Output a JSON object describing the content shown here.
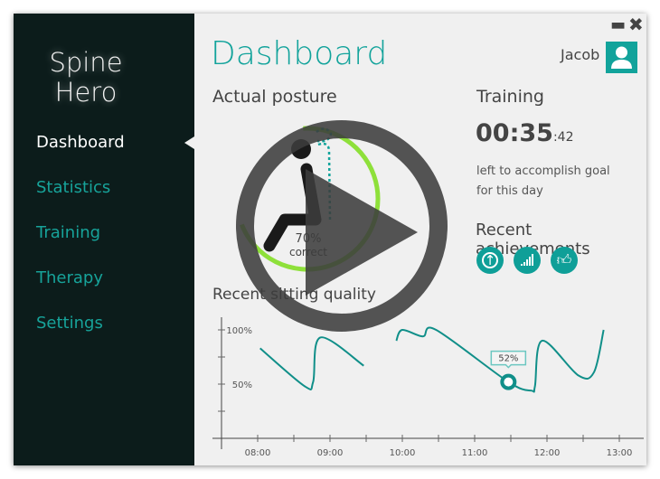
{
  "sidebar": {
    "brand_line1": "Spine",
    "brand_line2": "Hero",
    "items": [
      {
        "label": "Dashboard",
        "active": true
      },
      {
        "label": "Statistics"
      },
      {
        "label": "Training"
      },
      {
        "label": "Therapy"
      },
      {
        "label": "Settings"
      }
    ]
  },
  "header": {
    "title": "Dashboard",
    "user": "Jacob",
    "minimize_icon": "minimize-icon",
    "close_icon": "close-icon"
  },
  "posture": {
    "title": "Actual posture",
    "percent": "70%",
    "label": "correct",
    "correct_fraction": 0.7
  },
  "training": {
    "title": "Training",
    "time_main": "00:35",
    "time_seconds": ":42",
    "caption_line1": "left to accomplish goal",
    "caption_line2": "for this day"
  },
  "achievements": {
    "title": "Recent achievements",
    "icons": [
      "arrow-up-circle-icon",
      "signal-bars-icon",
      "thumbs-up-icon"
    ]
  },
  "overlay": {
    "icon": "play-icon"
  },
  "colors": {
    "accent": "#12a39b",
    "sidebar": "#0c1c1b",
    "arc": "#8ee03a"
  },
  "chart_data": {
    "type": "line",
    "title": "Recent sitting quality",
    "x_ticks": [
      "08:00",
      "09:00",
      "10:00",
      "11:00",
      "12:00",
      "13:00"
    ],
    "y_tick_labels": [
      "100%",
      "50%"
    ],
    "ylim": [
      0,
      100
    ],
    "xlim": [
      "07:30",
      "13:00"
    ],
    "segments": [
      [
        [
          "08:02",
          83
        ],
        [
          "08:39",
          48
        ],
        [
          "08:46",
          52
        ],
        [
          "08:52",
          93
        ],
        [
          "09:28",
          67
        ]
      ],
      [
        [
          "09:55",
          90
        ],
        [
          "10:00",
          100
        ],
        [
          "10:17",
          94
        ],
        [
          "10:28",
          100
        ],
        [
          "11:28",
          52
        ],
        [
          "11:47",
          44
        ],
        [
          "11:50",
          48
        ],
        [
          "11:56",
          90
        ],
        [
          "12:26",
          58
        ],
        [
          "12:39",
          61
        ],
        [
          "12:47",
          100
        ]
      ]
    ],
    "highlight": {
      "x": "11:28",
      "y": 52,
      "label": "52%"
    }
  }
}
